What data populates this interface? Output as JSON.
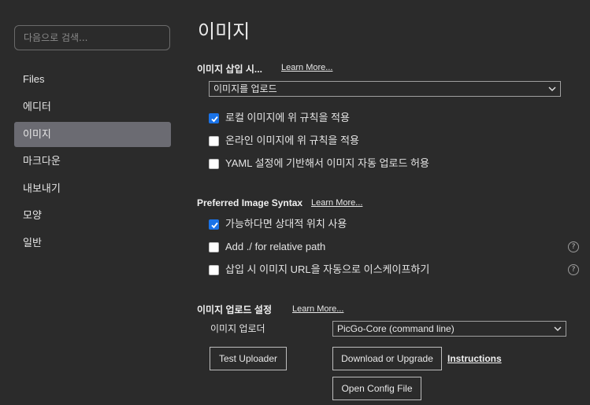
{
  "sidebar": {
    "search_placeholder": "다음으로 검색...",
    "items": [
      {
        "label": "Files"
      },
      {
        "label": "에디터"
      },
      {
        "label": "이미지"
      },
      {
        "label": "마크다운"
      },
      {
        "label": "내보내기"
      },
      {
        "label": "모양"
      },
      {
        "label": "일반"
      }
    ],
    "active_index": 2
  },
  "main": {
    "title": "이미지",
    "insert": {
      "heading": "이미지 삽입 시...",
      "learn_more": "Learn More...",
      "select_value": "이미지를 업로드",
      "options": [
        {
          "label": "로컬 이미지에 위 규칙을 적용",
          "checked": true
        },
        {
          "label": "온라인 이미지에 위 규칙을 적용",
          "checked": false
        },
        {
          "label": "YAML 설정에 기반해서 이미지 자동 업로드 허용",
          "checked": false
        }
      ]
    },
    "syntax": {
      "heading": "Preferred Image Syntax",
      "learn_more": "Learn More...",
      "options": [
        {
          "label": "가능하다면 상대적 위치 사용",
          "checked": true,
          "help": false
        },
        {
          "label": "Add ./ for relative path",
          "checked": false,
          "help": true
        },
        {
          "label": "삽입 시 이미지 URL을 자동으로 이스케이프하기",
          "checked": false,
          "help": true
        }
      ],
      "help_glyph": "?"
    },
    "upload": {
      "heading": "이미지 업로드 설정",
      "learn_more": "Learn More...",
      "uploader_label": "이미지 업로더",
      "uploader_value": "PicGo-Core (command line)",
      "test_button": "Test Uploader",
      "download_button": "Download or Upgrade",
      "instructions_link": "Instructions",
      "config_button": "Open Config File"
    }
  },
  "colors": {
    "background": "#2b2b2b",
    "active_nav": "#6b6b72",
    "checkbox_checked": "#1a73e8"
  }
}
